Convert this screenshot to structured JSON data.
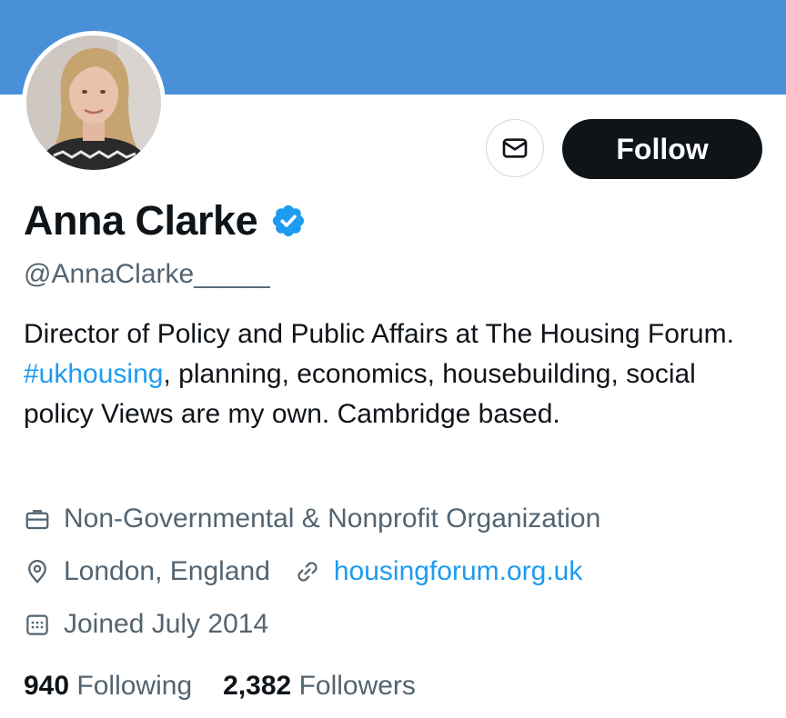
{
  "colors": {
    "banner": "#4a90d9",
    "accent": "#1d9bf0",
    "text": "#0f1419",
    "muted": "#536471",
    "follow_bg": "#0f1419"
  },
  "header": {
    "message_icon": "envelope-icon",
    "follow_label": "Follow"
  },
  "profile": {
    "name": "Anna Clarke",
    "verified_icon": "verified-badge-icon",
    "handle": "@AnnaClarke_____",
    "bio": {
      "before_hashtag": "Director of Policy and Public Affairs at The Housing Forum. ",
      "hashtag": "#ukhousing",
      "after_hashtag": ", planning, economics, housebuilding, social policy Views are my own. Cambridge based."
    },
    "category": "Non-Governmental & Nonprofit Organization",
    "location": "London, England",
    "website": "housingforum.org.uk",
    "joined": "Joined July 2014"
  },
  "stats": {
    "following_count": "940",
    "following_label": "Following",
    "followers_count": "2,382",
    "followers_label": "Followers"
  }
}
